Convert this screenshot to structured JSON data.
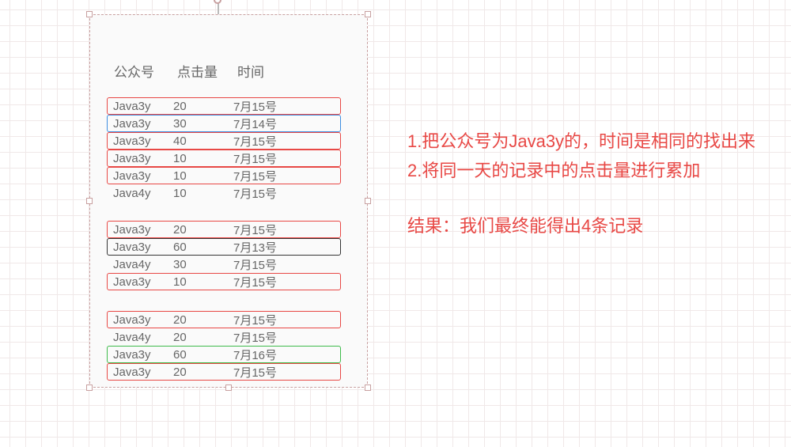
{
  "headers": {
    "col1": "公众号",
    "col2": "点击量",
    "col3": "时间"
  },
  "groups": [
    {
      "rows": [
        {
          "c1": "Java3y",
          "c2": "20",
          "c3": "7月15号",
          "box": "red"
        },
        {
          "c1": "Java3y",
          "c2": "30",
          "c3": "7月14号",
          "box": "blue"
        },
        {
          "c1": "Java3y",
          "c2": "40",
          "c3": "7月15号",
          "box": "red"
        },
        {
          "c1": "Java3y",
          "c2": "10",
          "c3": "7月15号",
          "box": "red"
        },
        {
          "c1": "Java3y",
          "c2": "10",
          "c3": "7月15号",
          "box": "red"
        },
        {
          "c1": "Java4y",
          "c2": "10",
          "c3": "7月15号",
          "box": "none"
        }
      ]
    },
    {
      "rows": [
        {
          "c1": "Java3y",
          "c2": "20",
          "c3": "7月15号",
          "box": "red"
        },
        {
          "c1": "Java3y",
          "c2": "60",
          "c3": "7月13号",
          "box": "black"
        },
        {
          "c1": "Java4y",
          "c2": "30",
          "c3": "7月15号",
          "box": "none"
        },
        {
          "c1": "Java3y",
          "c2": "10",
          "c3": "7月15号",
          "box": "red"
        }
      ]
    },
    {
      "rows": [
        {
          "c1": "Java3y",
          "c2": "20",
          "c3": "7月15号",
          "box": "red"
        },
        {
          "c1": "Java4y",
          "c2": "20",
          "c3": "7月15号",
          "box": "none"
        },
        {
          "c1": "Java3y",
          "c2": "60",
          "c3": "7月16号",
          "box": "green"
        },
        {
          "c1": "Java3y",
          "c2": "20",
          "c3": "7月15号",
          "box": "red"
        }
      ]
    }
  ],
  "annotations": {
    "line1": "1.把公众号为Java3y的，时间是相同的找出来",
    "line2": "2.将同一天的记录中的点击量进行累加",
    "result": "结果：我们最终能得出4条记录"
  }
}
